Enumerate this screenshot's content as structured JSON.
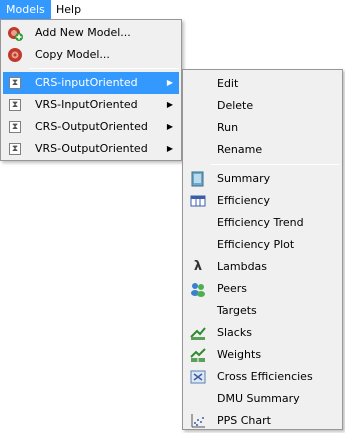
{
  "menubar": {
    "items": [
      {
        "label": "Models"
      },
      {
        "label": "Help"
      }
    ]
  },
  "models_menu": {
    "items": [
      {
        "label": "Add New Model...",
        "icon": "add-model-icon"
      },
      {
        "label": "Copy Model...",
        "icon": "copy-model-icon"
      },
      {
        "label": "CRS-inputOriented",
        "icon": "hourglass-icon"
      },
      {
        "label": "VRS-InputOriented",
        "icon": "hourglass-icon"
      },
      {
        "label": "CRS-OutputOriented",
        "icon": "hourglass-icon"
      },
      {
        "label": "VRS-OutputOriented",
        "icon": "hourglass-icon"
      }
    ]
  },
  "submenu": {
    "items": [
      {
        "label": "Edit"
      },
      {
        "label": "Delete"
      },
      {
        "label": "Run"
      },
      {
        "label": "Rename"
      },
      {
        "label": "Summary",
        "icon": "summary-icon"
      },
      {
        "label": "Efficiency",
        "icon": "efficiency-icon"
      },
      {
        "label": "Efficiency Trend"
      },
      {
        "label": "Efficiency Plot"
      },
      {
        "label": "Lambdas",
        "icon": "lambda-icon"
      },
      {
        "label": "Peers",
        "icon": "peers-icon"
      },
      {
        "label": "Targets"
      },
      {
        "label": "Slacks",
        "icon": "slacks-icon"
      },
      {
        "label": "Weights",
        "icon": "weights-icon"
      },
      {
        "label": "Cross Efficiencies",
        "icon": "cross-efficiencies-icon"
      },
      {
        "label": "DMU Summary"
      },
      {
        "label": "PPS Chart",
        "icon": "pps-chart-icon"
      }
    ]
  },
  "colors": {
    "highlight": "#3399ff",
    "menu_bg": "#f0f0f0"
  }
}
